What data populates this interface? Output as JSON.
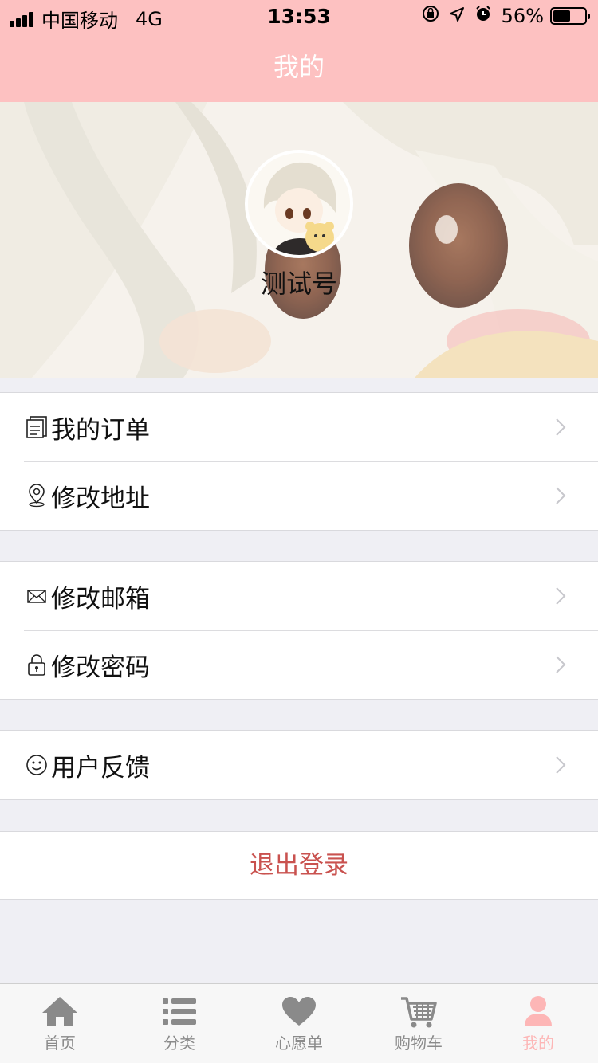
{
  "status_bar": {
    "carrier": "中国移动",
    "network": "4G",
    "time": "13:53",
    "battery_text": "56%",
    "battery_level": 0.56
  },
  "nav": {
    "title": "我的"
  },
  "profile": {
    "username": "测试号"
  },
  "menu_groups": [
    {
      "items": [
        {
          "label": "我的订单",
          "icon": "order-icon"
        },
        {
          "label": "修改地址",
          "icon": "location-pin-icon"
        }
      ]
    },
    {
      "items": [
        {
          "label": "修改邮箱",
          "icon": "mail-icon"
        },
        {
          "label": "修改密码",
          "icon": "lock-icon"
        }
      ]
    },
    {
      "items": [
        {
          "label": "用户反馈",
          "icon": "smiley-icon"
        }
      ]
    }
  ],
  "logout": {
    "label": "退出登录"
  },
  "tabs": [
    {
      "label": "首页",
      "icon": "home-icon"
    },
    {
      "label": "分类",
      "icon": "list-icon"
    },
    {
      "label": "心愿单",
      "icon": "heart-icon"
    },
    {
      "label": "购物车",
      "icon": "cart-icon"
    },
    {
      "label": "我的",
      "icon": "user-icon",
      "active": true
    }
  ],
  "colors": {
    "header_bg": "#fdc1c1",
    "logout_text": "#c9524f",
    "tab_active": "#fdb6b6",
    "tab_inactive": "#8a8a8a"
  }
}
